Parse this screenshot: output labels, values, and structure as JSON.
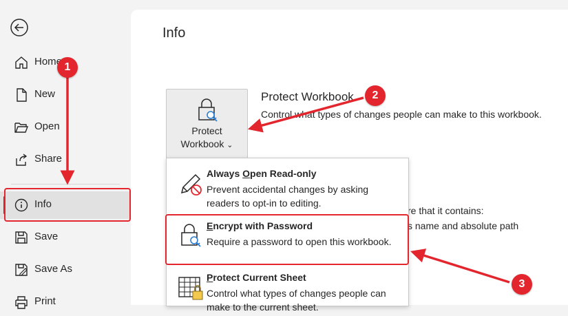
{
  "sidebar": {
    "back_icon": "back-arrow-icon",
    "items": [
      {
        "label": "Home",
        "icon": "home-icon"
      },
      {
        "label": "New",
        "icon": "new-document-icon"
      },
      {
        "label": "Open",
        "icon": "open-folder-icon"
      },
      {
        "label": "Share",
        "icon": "share-icon"
      },
      {
        "label": "Info",
        "icon": "info-icon",
        "active": true
      },
      {
        "label": "Save",
        "icon": "save-icon"
      },
      {
        "label": "Save As",
        "icon": "save-as-icon"
      },
      {
        "label": "Print",
        "icon": "print-icon"
      }
    ]
  },
  "page": {
    "title": "Info"
  },
  "protect": {
    "button_line1": "Protect",
    "button_line2": "Workbook",
    "chevron": "⌄",
    "section_title": "Protect Workbook",
    "section_desc": "Control what types of changes people can make to this workbook."
  },
  "background_text": {
    "line1": "re that it contains:",
    "line2": "s name and absolute path"
  },
  "menu": {
    "items": [
      {
        "title_underlined": "O",
        "title_before": "Always ",
        "title_after": "pen Read-only",
        "desc": "Prevent accidental changes by asking readers to opt-in to editing.",
        "icon": "pencil-no-edit-icon"
      },
      {
        "title_underlined": "E",
        "title_before": "",
        "title_after": "ncrypt with Password",
        "desc": "Require a password to open this workbook.",
        "icon": "lock-key-icon"
      },
      {
        "title_underlined": "P",
        "title_before": "",
        "title_after": "rotect Current Sheet",
        "desc": "Control what types of changes people can make to the current sheet.",
        "icon": "sheet-lock-icon"
      }
    ]
  },
  "callouts": {
    "badge1": "1",
    "badge2": "2",
    "badge3": "3",
    "color": "#e3262d"
  },
  "accent_color": "#1e7145"
}
